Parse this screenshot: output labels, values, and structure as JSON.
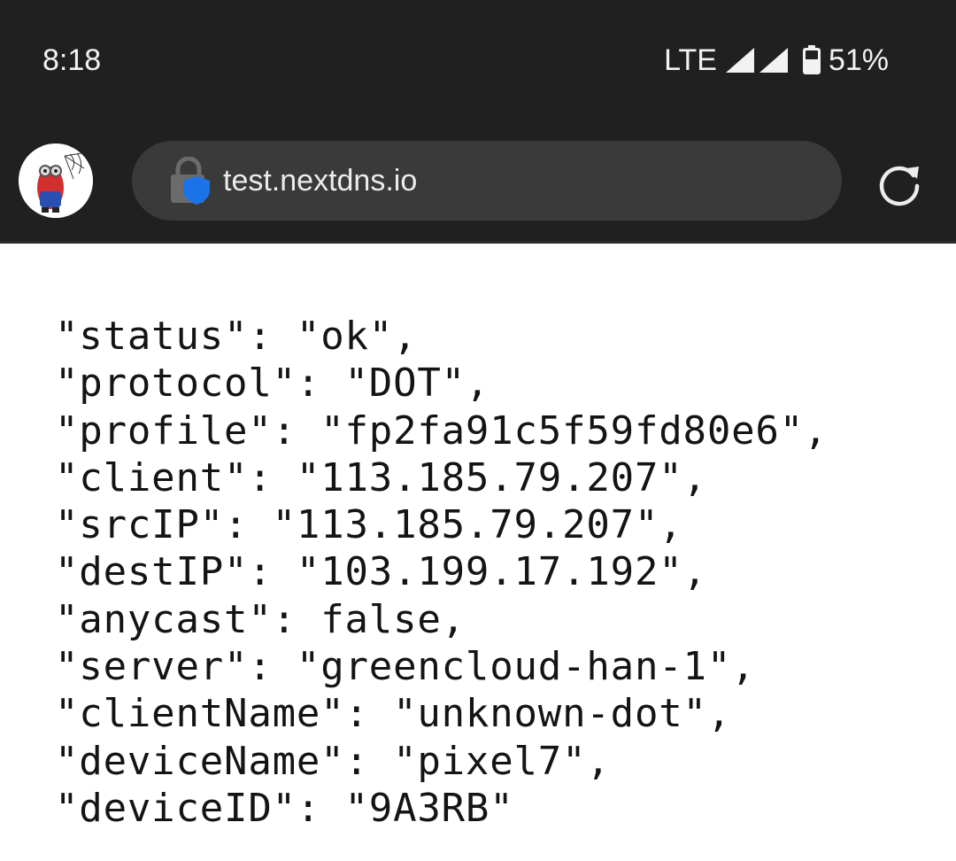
{
  "status_bar": {
    "time": "8:18",
    "network": "LTE",
    "battery": "51%",
    "icons": [
      "signal-icon",
      "signal-icon",
      "battery-icon"
    ]
  },
  "browser": {
    "url": "test.nextdns.io",
    "icons": [
      "profile-avatar",
      "lock-icon",
      "shield-icon",
      "reload-icon"
    ]
  },
  "page": {
    "lines": [
      "\"status\": \"ok\",",
      "\"protocol\": \"DOT\",",
      "\"profile\": \"fp2fa91c5f59fd80e6\",",
      "\"client\": \"113.185.79.207\",",
      "\"srcIP\": \"113.185.79.207\",",
      "\"destIP\": \"103.199.17.192\",",
      "\"anycast\": false,",
      "\"server\": \"greencloud-han-1\",",
      "\"clientName\": \"unknown-dot\",",
      "\"deviceName\": \"pixel7\",",
      "\"deviceID\": \"9A3RB\""
    ]
  },
  "colors": {
    "chrome_bg": "#202020",
    "urlbar_bg": "#3a3a3a",
    "shield_blue": "#1a73e8",
    "text_dark": "#141414"
  }
}
